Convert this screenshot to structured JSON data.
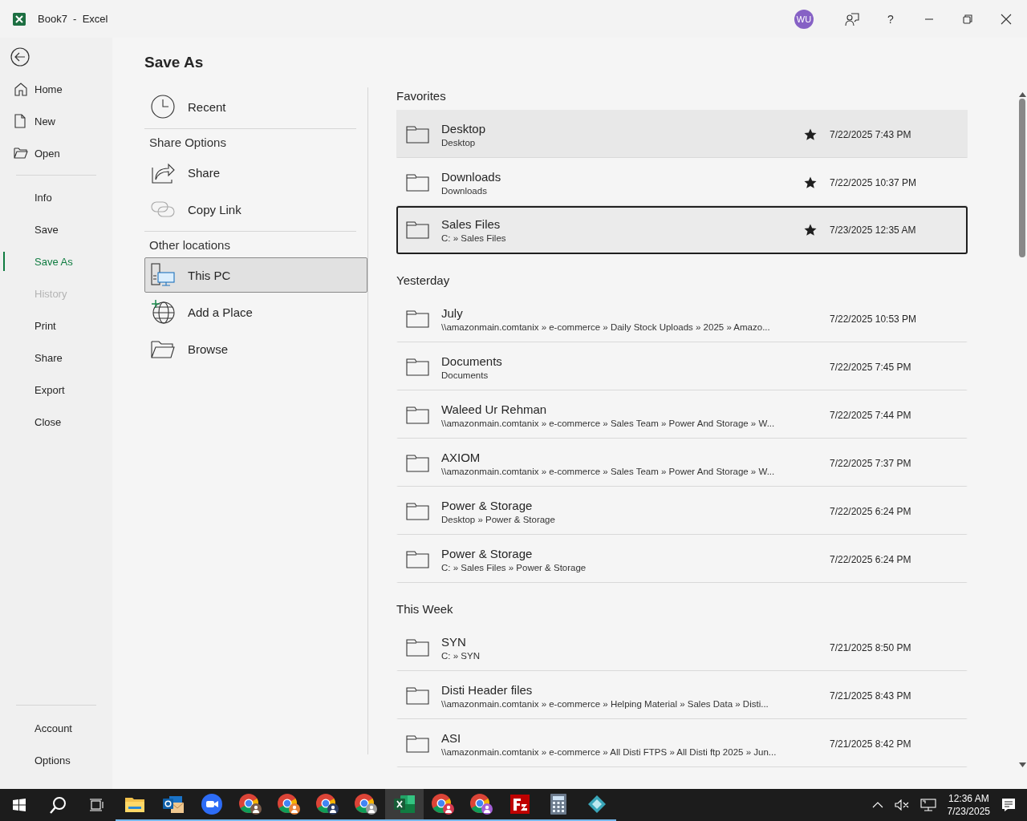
{
  "title_bar": {
    "title": "Book7  -  Excel",
    "avatar": "WU",
    "help": "?"
  },
  "nav": {
    "top": [
      {
        "label": "Home",
        "selected": false,
        "disabled": false
      },
      {
        "label": "New",
        "selected": false,
        "disabled": false
      },
      {
        "label": "Open",
        "selected": false,
        "disabled": false
      }
    ],
    "middle": [
      {
        "label": "Info",
        "selected": false,
        "disabled": false
      },
      {
        "label": "Save",
        "selected": false,
        "disabled": false
      },
      {
        "label": "Save As",
        "selected": true,
        "disabled": false
      },
      {
        "label": "History",
        "selected": false,
        "disabled": true
      },
      {
        "label": "Print",
        "selected": false,
        "disabled": false
      },
      {
        "label": "Share",
        "selected": false,
        "disabled": false
      },
      {
        "label": "Export",
        "selected": false,
        "disabled": false
      },
      {
        "label": "Close",
        "selected": false,
        "disabled": false
      }
    ],
    "bottom": [
      {
        "label": "Account",
        "selected": false,
        "disabled": false
      },
      {
        "label": "Options",
        "selected": false,
        "disabled": false
      }
    ]
  },
  "heading": "Save As",
  "locations": [
    {
      "kind": "item",
      "label": "Recent",
      "selected": false
    },
    {
      "kind": "header",
      "label": "Share Options"
    },
    {
      "kind": "item",
      "label": "Share",
      "selected": false
    },
    {
      "kind": "item",
      "label": "Copy Link",
      "selected": false
    },
    {
      "kind": "header",
      "label": "Other locations"
    },
    {
      "kind": "item",
      "label": "This PC",
      "selected": true
    },
    {
      "kind": "item",
      "label": "Add a Place",
      "selected": false
    },
    {
      "kind": "item",
      "label": "Browse",
      "selected": false
    }
  ],
  "folder_groups": [
    {
      "title": "Favorites",
      "folders": [
        {
          "name": "Desktop",
          "path": "Desktop",
          "date": "7/22/2025 7:43 PM",
          "pinned": true,
          "hovered": true,
          "selected": false
        },
        {
          "name": "Downloads",
          "path": "Downloads",
          "date": "7/22/2025 10:37 PM",
          "pinned": true,
          "hovered": false,
          "selected": false
        },
        {
          "name": "Sales Files",
          "path": "C: » Sales Files",
          "date": "7/23/2025 12:35 AM",
          "pinned": true,
          "hovered": false,
          "selected": true
        }
      ]
    },
    {
      "title": "Yesterday",
      "folders": [
        {
          "name": "July",
          "path": "\\\\amazonmain.comtanix » e-commerce » Daily Stock Uploads » 2025 » Amazo...",
          "date": "7/22/2025 10:53 PM",
          "pinned": false,
          "hovered": false,
          "selected": false
        },
        {
          "name": "Documents",
          "path": "Documents",
          "date": "7/22/2025 7:45 PM",
          "pinned": false,
          "hovered": false,
          "selected": false
        },
        {
          "name": "Waleed Ur Rehman",
          "path": "\\\\amazonmain.comtanix » e-commerce » Sales Team » Power And Storage » W...",
          "date": "7/22/2025 7:44 PM",
          "pinned": false,
          "hovered": false,
          "selected": false
        },
        {
          "name": "AXIOM",
          "path": "\\\\amazonmain.comtanix » e-commerce » Sales Team » Power And Storage » W...",
          "date": "7/22/2025 7:37 PM",
          "pinned": false,
          "hovered": false,
          "selected": false
        },
        {
          "name": "Power & Storage",
          "path": "Desktop » Power & Storage",
          "date": "7/22/2025 6:24 PM",
          "pinned": false,
          "hovered": false,
          "selected": false
        },
        {
          "name": "Power & Storage",
          "path": "C: » Sales Files » Power & Storage",
          "date": "7/22/2025 6:24 PM",
          "pinned": false,
          "hovered": false,
          "selected": false
        }
      ]
    },
    {
      "title": "This Week",
      "folders": [
        {
          "name": "SYN",
          "path": "C: » SYN",
          "date": "7/21/2025 8:50 PM",
          "pinned": false,
          "hovered": false,
          "selected": false
        },
        {
          "name": "Disti Header files",
          "path": "\\\\amazonmain.comtanix » e-commerce » Helping Material » Sales Data » Disti...",
          "date": "7/21/2025 8:43 PM",
          "pinned": false,
          "hovered": false,
          "selected": false
        },
        {
          "name": "ASI",
          "path": "\\\\amazonmain.comtanix » e-commerce » All Disti FTPS » All Disti ftp 2025 » Jun...",
          "date": "7/21/2025 8:42 PM",
          "pinned": false,
          "hovered": false,
          "selected": false
        }
      ]
    }
  ],
  "taskbar": {
    "apps": [
      {
        "kind": "explorer",
        "running": true,
        "selected": false
      },
      {
        "kind": "outlook",
        "running": true,
        "selected": false
      },
      {
        "kind": "zoom",
        "running": true,
        "selected": false
      },
      {
        "kind": "chrome",
        "color": "#7a5c4a",
        "running": true,
        "selected": false
      },
      {
        "kind": "chrome",
        "color": "#e8833a",
        "running": true,
        "selected": false
      },
      {
        "kind": "chrome",
        "color": "#2c3e66",
        "running": true,
        "selected": false
      },
      {
        "kind": "chrome",
        "color": "#9a9a9a",
        "running": true,
        "selected": false
      },
      {
        "kind": "excel",
        "running": true,
        "selected": true
      },
      {
        "kind": "chrome",
        "color": "#d83a50",
        "running": true,
        "selected": false
      },
      {
        "kind": "chrome",
        "color": "#a560d8",
        "running": true,
        "selected": false
      },
      {
        "kind": "filezilla",
        "running": true,
        "selected": false
      },
      {
        "kind": "calculator",
        "running": true,
        "selected": false
      },
      {
        "kind": "app",
        "running": true,
        "selected": false
      }
    ],
    "time": "12:36 AM",
    "date": "7/23/2025"
  }
}
